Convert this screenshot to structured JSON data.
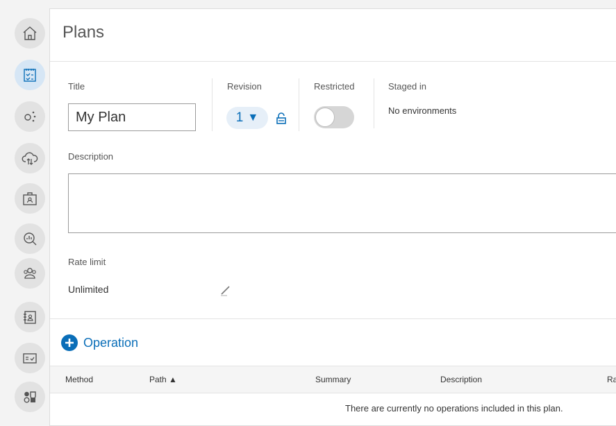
{
  "sidebar": {
    "items": [
      {
        "icon": "home-icon"
      },
      {
        "icon": "plans-icon",
        "active": true
      },
      {
        "icon": "connections-icon"
      },
      {
        "icon": "cloud-icon"
      },
      {
        "icon": "briefcase-icon"
      },
      {
        "icon": "analytics-icon"
      },
      {
        "icon": "users-icon"
      },
      {
        "icon": "contacts-icon"
      },
      {
        "icon": "approval-icon"
      },
      {
        "icon": "apps-icon"
      }
    ]
  },
  "page": {
    "title": "Plans"
  },
  "form": {
    "title_label": "Title",
    "title_value": "My Plan",
    "revision_label": "Revision",
    "revision_value": "1",
    "revision_caret": "▼",
    "restricted_label": "Restricted",
    "restricted_on": false,
    "staged_label": "Staged in",
    "staged_value": "No environments",
    "description_label": "Description",
    "description_value": "",
    "rate_limit_label": "Rate limit",
    "rate_limit_value": "Unlimited"
  },
  "operations": {
    "add_label": "Operation",
    "columns": [
      "Method",
      "Path ▲",
      "Summary",
      "Description",
      "Ra"
    ],
    "empty_message": "There are currently no operations included in this plan."
  },
  "colors": {
    "accent": "#0a6eb8",
    "active_nav_bg": "#d6e6f5"
  }
}
